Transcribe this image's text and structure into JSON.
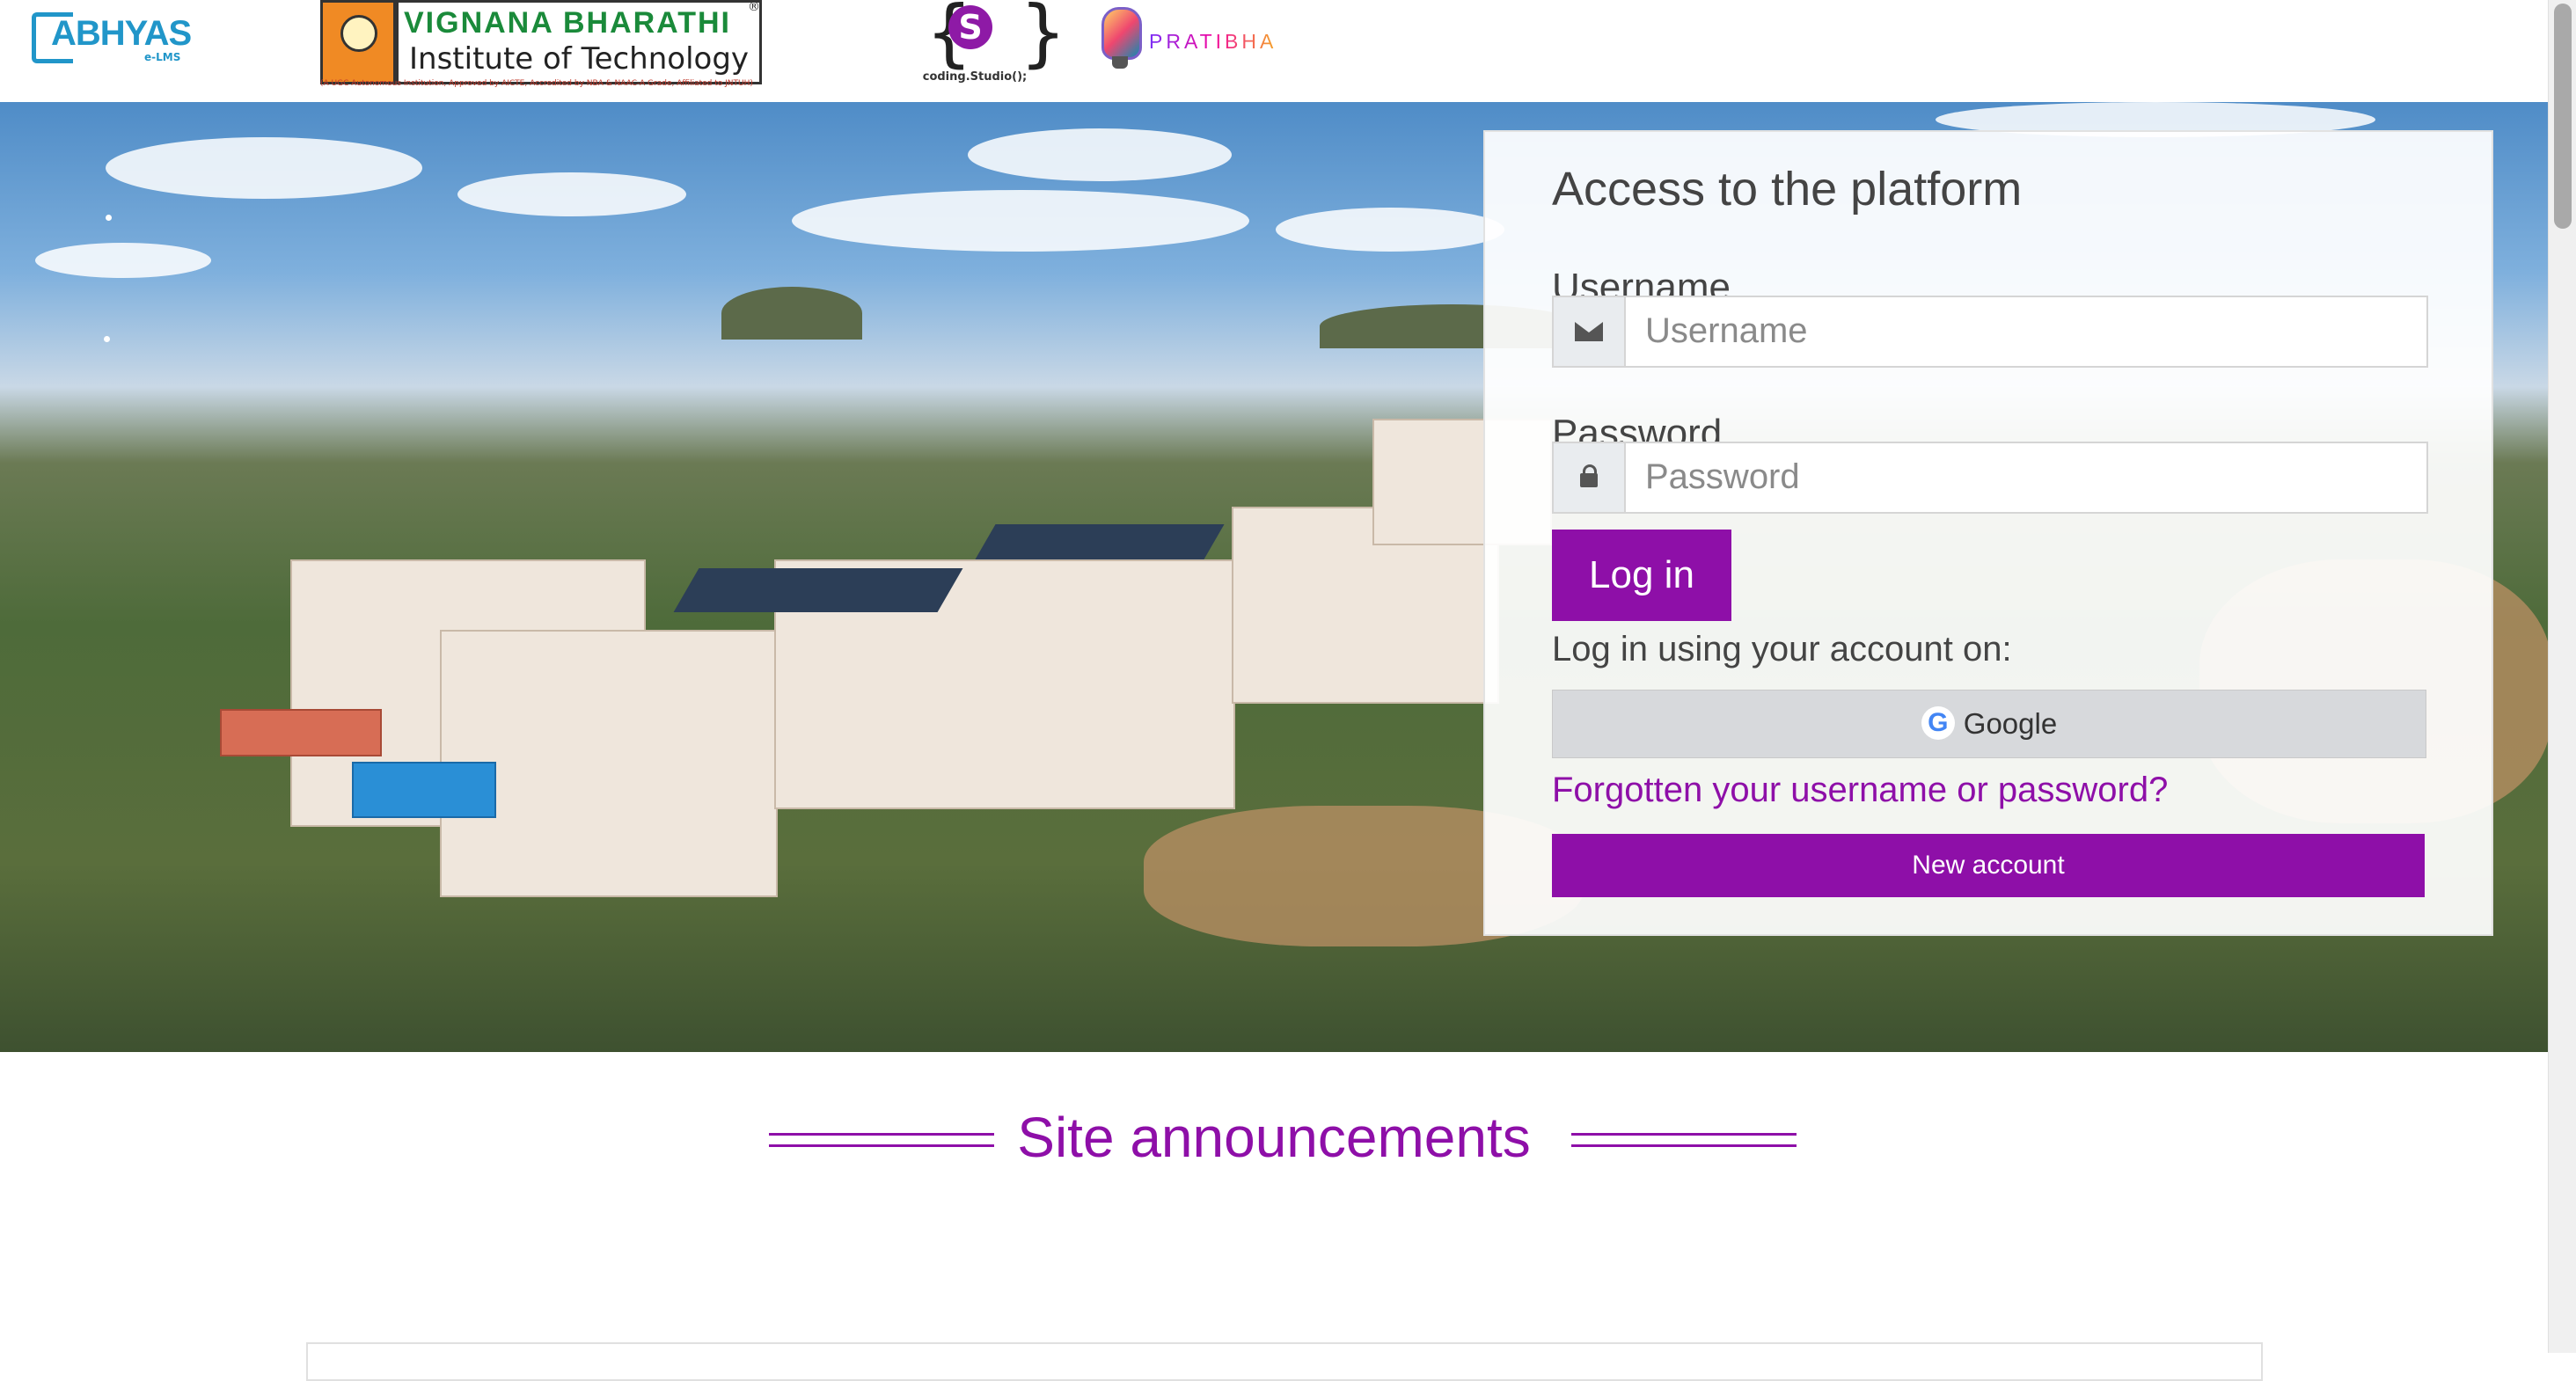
{
  "header": {
    "logos": {
      "abhyas": {
        "name": "ABHYAS",
        "sub": "e-LMS"
      },
      "vbit": {
        "line1": "VIGNANA BHARATHI",
        "line2": "Institute of Technology",
        "registered": "®",
        "tagline": "(A UGC Autonomous Institution, Approved by AICTE, Accredited by NBA & NAAC-A Grade, Affiliated to JNTUH)"
      },
      "coding_studio": {
        "letter": "S",
        "name": "coding.Studio();"
      },
      "pratibha": {
        "name": "PRATIBHA"
      }
    }
  },
  "login": {
    "title": "Access to the platform",
    "username_label": "Username",
    "username_placeholder": "Username",
    "password_label": "Password",
    "password_placeholder": "Password",
    "login_button": "Log in",
    "alt_login_text": "Log in using your account on:",
    "google_button": "Google",
    "forgot_link": "Forgotten your username or password?",
    "new_account_button": "New account"
  },
  "announcements": {
    "title": "Site announcements"
  },
  "colors": {
    "accent": "#8e0fa8",
    "google_bg": "#d7d9dc"
  }
}
